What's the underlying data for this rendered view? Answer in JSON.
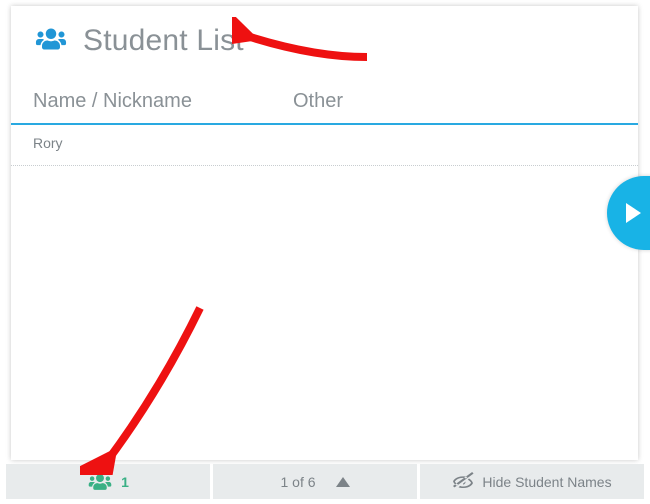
{
  "header": {
    "title": "Student List"
  },
  "columns": {
    "name": "Name / Nickname",
    "other": "Other"
  },
  "rows": [
    {
      "name": "Rory"
    }
  ],
  "footer": {
    "student_count": "1",
    "pager": "1 of 6",
    "hide_label": "Hide Student Names"
  }
}
